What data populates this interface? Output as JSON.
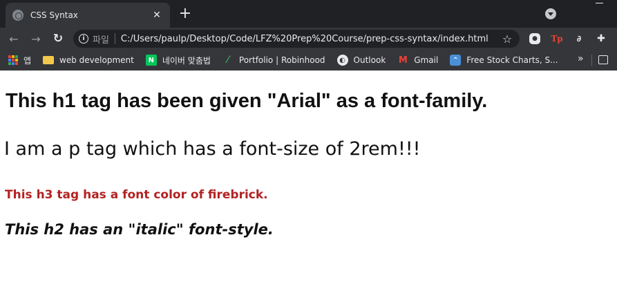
{
  "browser": {
    "tab": {
      "title": "CSS Syntax"
    },
    "address_bar": {
      "scheme_label": "파일",
      "url": "C:/Users/paulp/Desktop/Code/LFZ%20Prep%20Course/prep-css-syntax/index.html"
    },
    "extensions": {
      "tp_label": "Tp"
    },
    "bookmarks": [
      {
        "label": "앱",
        "icon": "apps-grid-icon"
      },
      {
        "label": "web development",
        "icon": "folder-icon"
      },
      {
        "label": "네이버 맞춤법",
        "icon": "naver-icon"
      },
      {
        "label": "Portfolio | Robinhood",
        "icon": "robinhood-leaf-icon"
      },
      {
        "label": "Outlook",
        "icon": "globe-icon"
      },
      {
        "label": "Gmail",
        "icon": "gmail-icon"
      },
      {
        "label": "Free Stock Charts, S...",
        "icon": "stock-charts-icon"
      }
    ]
  },
  "page": {
    "h1": "This h1 tag has been given \"Arial\" as a font-family.",
    "p": "I am a p tag which has a font-size of 2rem!!!",
    "h3": "This h3 tag has a font color of firebrick.",
    "h2": "This h2 has an \"italic\" font-style."
  },
  "colors": {
    "chrome_dark": "#202124",
    "chrome_toolbar": "#35363a",
    "firebrick": "#b22222"
  }
}
